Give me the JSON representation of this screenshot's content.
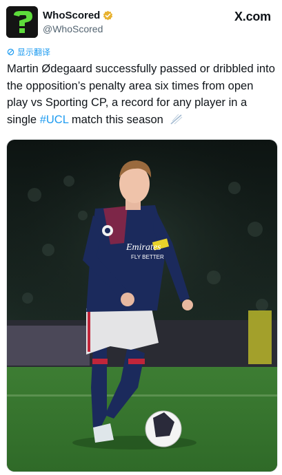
{
  "account": {
    "name": "WhoScored",
    "handle": "@WhoScored",
    "verified": true,
    "avatar_icon": "question-mark-logo"
  },
  "source": {
    "label": "X.com"
  },
  "translate": {
    "label": "显示翻译"
  },
  "tweet": {
    "text_before": "Martin Ødegaard successfully passed or dribbled into the opposition’s penalty area six times from open play vs Sporting CP, a record for any player in a single ",
    "hashtag": "#UCL",
    "text_after": " match this season"
  },
  "image": {
    "alt_subject": "football-player-photo",
    "shirt_sponsor_line1": "Emirates",
    "shirt_sponsor_line2": "FLY BETTER"
  },
  "colors": {
    "link": "#1d9bf0",
    "verified_badge": "#e8b230",
    "logo_green": "#5ddc3b",
    "kit_navy": "#1b2a5c"
  }
}
